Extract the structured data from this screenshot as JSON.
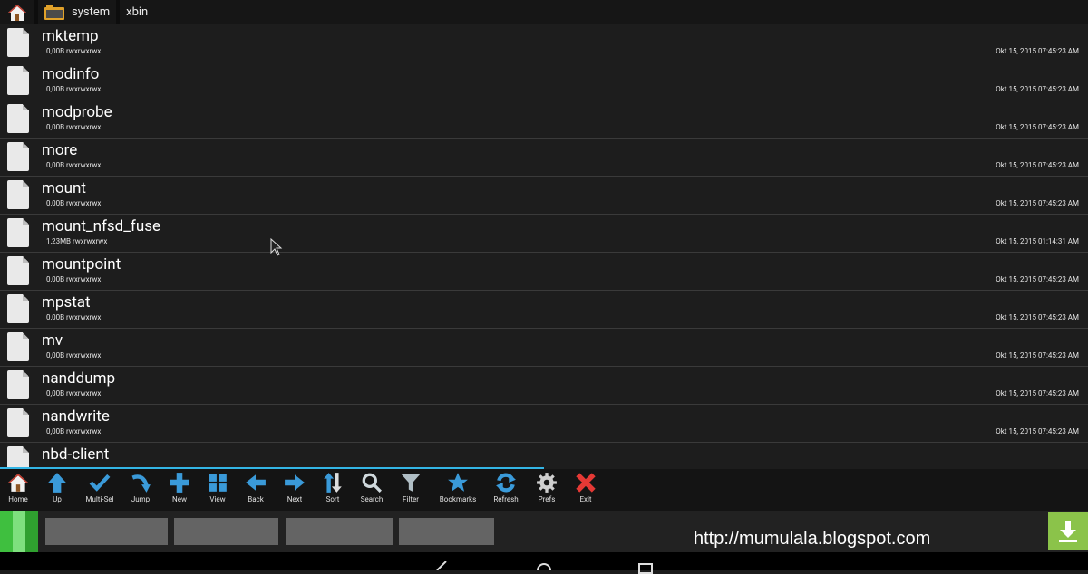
{
  "path": {
    "segments": [
      "system",
      "xbin"
    ]
  },
  "files": [
    {
      "name": "mktemp",
      "size": "0,00B",
      "perms": "rwxrwxrwx",
      "date": "Okt 15, 2015 07:45:23 AM"
    },
    {
      "name": "modinfo",
      "size": "0,00B",
      "perms": "rwxrwxrwx",
      "date": "Okt 15, 2015 07:45:23 AM"
    },
    {
      "name": "modprobe",
      "size": "0,00B",
      "perms": "rwxrwxrwx",
      "date": "Okt 15, 2015 07:45:23 AM"
    },
    {
      "name": "more",
      "size": "0,00B",
      "perms": "rwxrwxrwx",
      "date": "Okt 15, 2015 07:45:23 AM"
    },
    {
      "name": "mount",
      "size": "0,00B",
      "perms": "rwxrwxrwx",
      "date": "Okt 15, 2015 07:45:23 AM"
    },
    {
      "name": "mount_nfsd_fuse",
      "size": "1,23MB",
      "perms": "rwxrwxrwx",
      "date": "Okt 15, 2015 01:14:31 AM"
    },
    {
      "name": "mountpoint",
      "size": "0,00B",
      "perms": "rwxrwxrwx",
      "date": "Okt 15, 2015 07:45:23 AM"
    },
    {
      "name": "mpstat",
      "size": "0,00B",
      "perms": "rwxrwxrwx",
      "date": "Okt 15, 2015 07:45:23 AM"
    },
    {
      "name": "mv",
      "size": "0,00B",
      "perms": "rwxrwxrwx",
      "date": "Okt 15, 2015 07:45:23 AM"
    },
    {
      "name": "nanddump",
      "size": "0,00B",
      "perms": "rwxrwxrwx",
      "date": "Okt 15, 2015 07:45:23 AM"
    },
    {
      "name": "nandwrite",
      "size": "0,00B",
      "perms": "rwxrwxrwx",
      "date": "Okt 15, 2015 07:45:23 AM"
    },
    {
      "name": "nbd-client",
      "size": "",
      "perms": "",
      "date": ""
    }
  ],
  "toolbar": [
    {
      "label": "Home",
      "icon": "home-icon"
    },
    {
      "label": "Up",
      "icon": "up-arrow-icon"
    },
    {
      "label": "Multi-Sel",
      "icon": "checkmark-icon"
    },
    {
      "label": "Jump",
      "icon": "jump-arrow-icon"
    },
    {
      "label": "New",
      "icon": "plus-icon"
    },
    {
      "label": "View",
      "icon": "grid-view-icon"
    },
    {
      "label": "Back",
      "icon": "back-arrow-icon"
    },
    {
      "label": "Next",
      "icon": "next-arrow-icon"
    },
    {
      "label": "Sort",
      "icon": "sort-icon"
    },
    {
      "label": "Search",
      "icon": "magnifier-icon"
    },
    {
      "label": "Filter",
      "icon": "funnel-icon"
    },
    {
      "label": "Bookmarks",
      "icon": "star-icon"
    },
    {
      "label": "Refresh",
      "icon": "refresh-icon"
    },
    {
      "label": "Prefs",
      "icon": "gear-icon"
    },
    {
      "label": "Exit",
      "icon": "x-icon"
    }
  ],
  "ad": {
    "url": "http://mumulala.blogspot.com"
  },
  "colors": {
    "accent": "#33b5e5",
    "toolbar_blue": "#3a9ad9",
    "exit_red": "#e53935",
    "download_green": "#8bc34a"
  }
}
